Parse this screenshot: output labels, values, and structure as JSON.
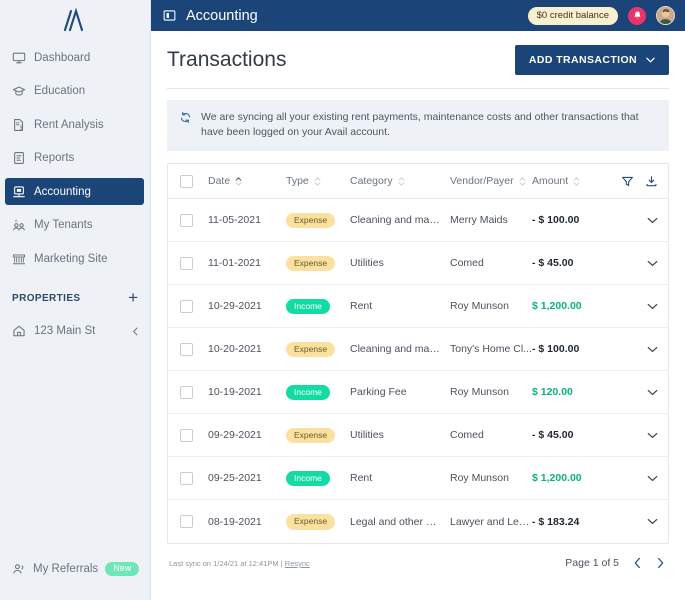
{
  "sidebar": {
    "logo": "avail-logo",
    "items": [
      {
        "label": "Dashboard",
        "icon": "monitor-icon",
        "active": false
      },
      {
        "label": "Education",
        "icon": "graduation-cap-icon",
        "active": false
      },
      {
        "label": "Rent Analysis",
        "icon": "document-dollar-icon",
        "active": false
      },
      {
        "label": "Reports",
        "icon": "report-icon",
        "active": false
      },
      {
        "label": "Accounting",
        "icon": "accounting-icon",
        "active": true
      },
      {
        "label": "My Tenants",
        "icon": "people-icon",
        "active": false
      },
      {
        "label": "Marketing Site",
        "icon": "marketing-site-icon",
        "active": false
      }
    ],
    "properties": {
      "title": "PROPERTIES",
      "add_icon": "plus-icon",
      "items": [
        {
          "label": "123 Main St",
          "icon": "home-icon",
          "collapse_icon": "chevron-left-icon"
        }
      ]
    },
    "referrals": {
      "label": "My Referrals",
      "icon": "referrals-people-icon",
      "badge": "New",
      "badge_color": "#6ee7b7"
    }
  },
  "topbar": {
    "panel_icon": "panel-toggle-icon",
    "title": "Accounting",
    "credit_balance": "$0 credit balance",
    "notifications_icon": "bell-icon",
    "avatar": "user-avatar",
    "bg_color": "#1b4479",
    "pill_color": "#faf0ce",
    "bell_color": "#e8346a"
  },
  "page": {
    "title": "Transactions",
    "add_button": {
      "label": "ADD TRANSACTION",
      "icon": "chevron-down-icon"
    },
    "notice": {
      "icon": "sync-icon",
      "text": "We are syncing all your existing rent payments, maintenance costs and other transactions that have been logged on your Avail account."
    }
  },
  "table": {
    "header": {
      "select_all": "select-all-checkbox",
      "columns": [
        {
          "label": "Date",
          "sortable": true,
          "sort_active": "asc"
        },
        {
          "label": "Type",
          "sortable": true,
          "sort_active": "none"
        },
        {
          "label": "Category",
          "sortable": true,
          "sort_active": "none"
        },
        {
          "label": "Vendor/Payer",
          "sortable": true,
          "sort_active": "none"
        },
        {
          "label": "Amount",
          "sortable": true,
          "sort_active": "none"
        }
      ],
      "filter_icon": "filter-funnel-icon",
      "download_icon": "download-icon"
    },
    "rows": [
      {
        "date": "11-05-2021",
        "type": "Expense",
        "category": "Cleaning and maintenance",
        "vendor": "Merry Maids",
        "amount": "- $ 100.00",
        "sign": "neg"
      },
      {
        "date": "11-01-2021",
        "type": "Expense",
        "category": "Utilities",
        "vendor": "Comed",
        "amount": "- $ 45.00",
        "sign": "neg"
      },
      {
        "date": "10-29-2021",
        "type": "Income",
        "category": "Rent",
        "vendor": "Roy Munson",
        "amount": "$ 1,200.00",
        "sign": "pos"
      },
      {
        "date": "10-20-2021",
        "type": "Expense",
        "category": "Cleaning and maintenance",
        "vendor": "Tony's Home Cl...",
        "amount": "- $ 100.00",
        "sign": "neg"
      },
      {
        "date": "10-19-2021",
        "type": "Income",
        "category": "Parking Fee",
        "vendor": "Roy Munson",
        "amount": "$ 120.00",
        "sign": "pos"
      },
      {
        "date": "09-29-2021",
        "type": "Expense",
        "category": "Utilities",
        "vendor": "Comed",
        "amount": "- $ 45.00",
        "sign": "neg"
      },
      {
        "date": "09-25-2021",
        "type": "Income",
        "category": "Rent",
        "vendor": "Roy Munson",
        "amount": "$ 1,200.00",
        "sign": "pos"
      },
      {
        "date": "08-19-2021",
        "type": "Expense",
        "category": "Legal and other profession...",
        "vendor": "Lawyer and Leg...",
        "amount": "- $ 183.24",
        "sign": "neg"
      }
    ],
    "row_expand_icon": "chevron-down-icon",
    "income_color": "#13dba4",
    "expense_color": "#fae1a0"
  },
  "footer": {
    "sync_text": "Last sync on 1/24/21 at 12:41PM | ",
    "resync_label": "Resync",
    "page_label": "Page 1 of 5",
    "prev_icon": "chevron-left-icon",
    "next_icon": "chevron-right-icon"
  }
}
